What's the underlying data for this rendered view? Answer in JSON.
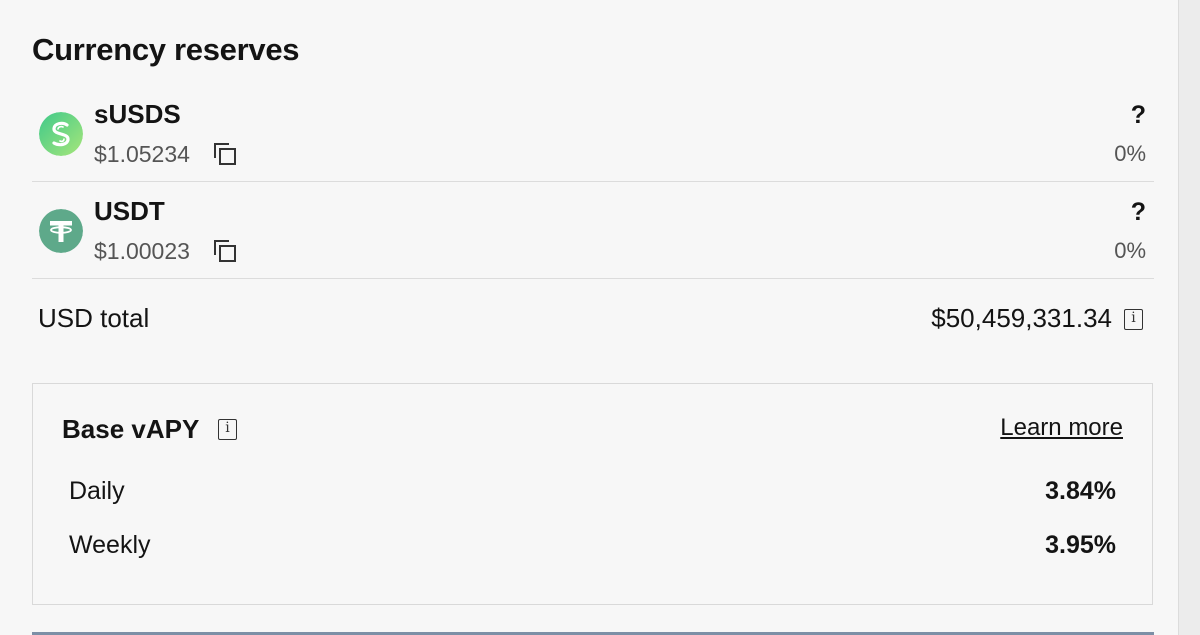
{
  "title": "Currency reserves",
  "reserves": [
    {
      "name": "sUSDS",
      "price": "$1.05234",
      "status": "?",
      "share": "0%",
      "icon": "susds-logo-icon",
      "color": "#5fd38f"
    },
    {
      "name": "USDT",
      "price": "$1.00023",
      "status": "?",
      "share": "0%",
      "icon": "tether-logo-icon",
      "color": "#5ea98a"
    }
  ],
  "total": {
    "label": "USD total",
    "value": "$50,459,331.34"
  },
  "vapy": {
    "title": "Base vAPY",
    "learn_more": "Learn more",
    "daily_label": "Daily",
    "daily_value": "3.84%",
    "weekly_label": "Weekly",
    "weekly_value": "3.95%"
  },
  "icons": {
    "info": "i"
  }
}
